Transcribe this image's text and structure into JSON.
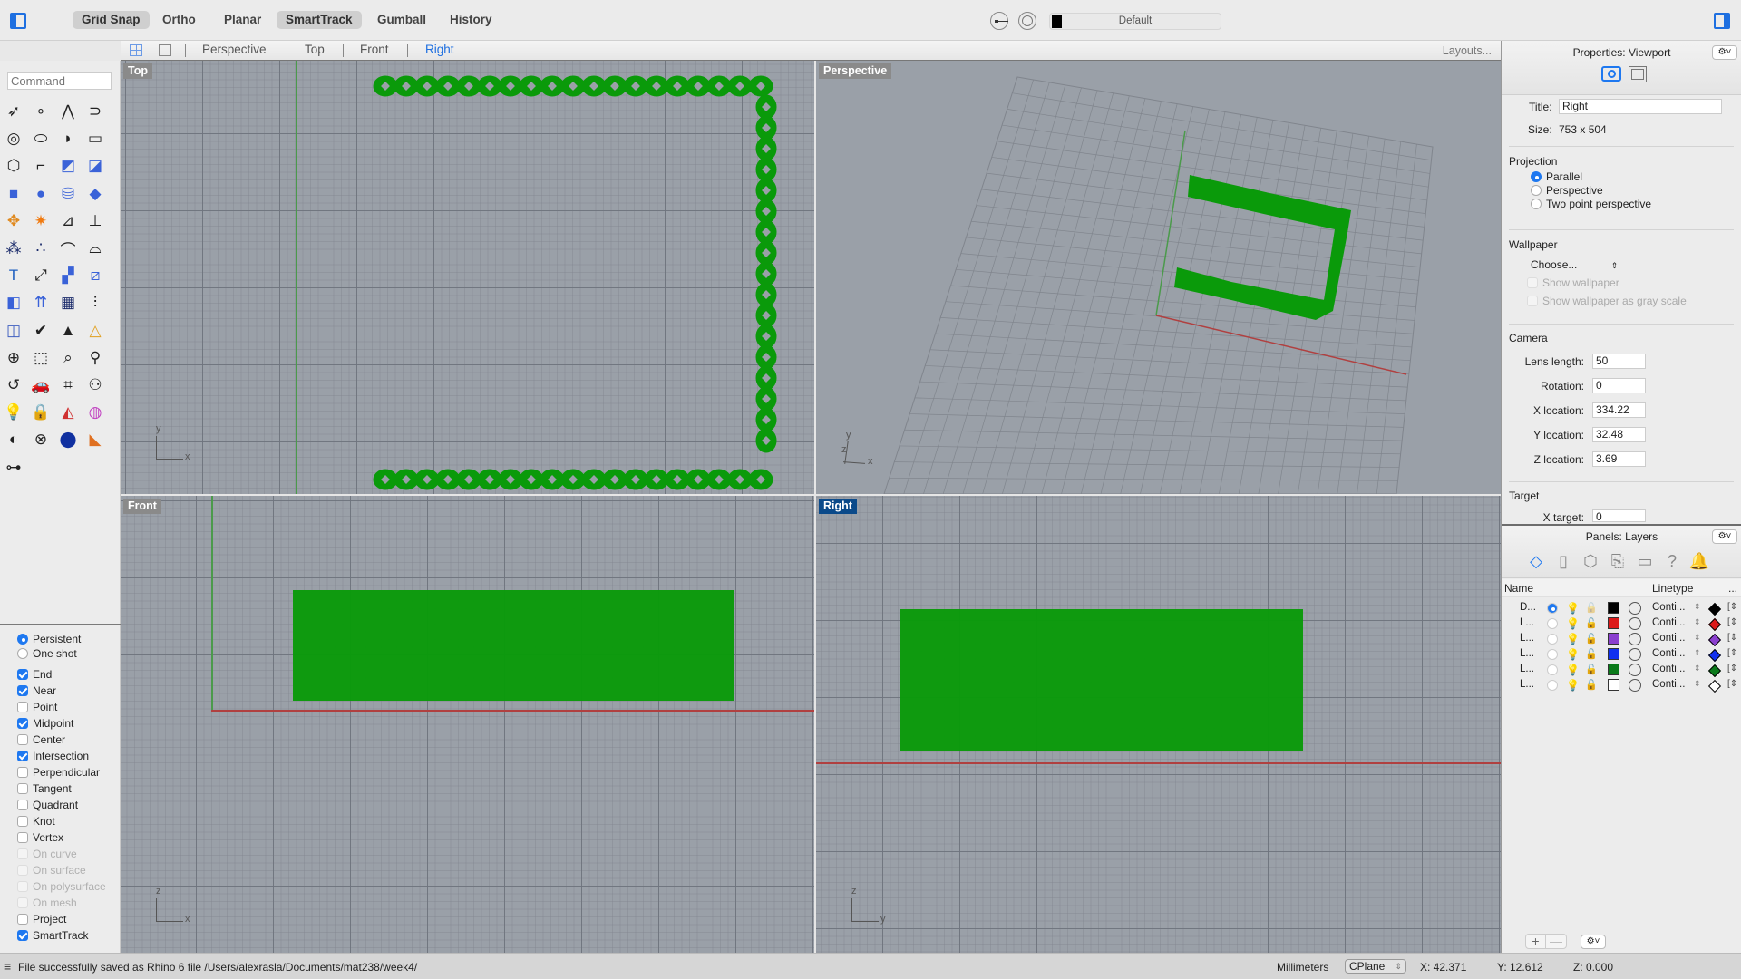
{
  "toolbar": {
    "modes": [
      {
        "label": "Grid Snap",
        "active": true
      },
      {
        "label": "Ortho",
        "active": false
      },
      {
        "label": "Planar",
        "active": false
      },
      {
        "label": "SmartTrack",
        "active": true
      },
      {
        "label": "Gumball",
        "active": false
      },
      {
        "label": "History",
        "active": false
      }
    ],
    "current_layer": "Default",
    "current_layer_color": "#000000"
  },
  "viewport_tabs": {
    "tabs": [
      "Perspective",
      "Top",
      "Front",
      "Right"
    ],
    "active": "Right",
    "layouts_label": "Layouts..."
  },
  "command": {
    "placeholder": "Command"
  },
  "tool_icons": [
    "select-arrow-icon",
    "point-icon",
    "polyline-icon",
    "curve-icon",
    "circle-icon",
    "ellipse-icon",
    "arc-icon",
    "rectangle-icon",
    "polygon-icon",
    "fillet-icon",
    "surface-from-points-icon",
    "sweep-surface-icon",
    "box-icon",
    "sphere-icon",
    "cylinder-icon",
    "extrude-surface-icon",
    "boolean-union-icon",
    "explode-icon",
    "trim-icon",
    "split-icon",
    "group-icon",
    "ungroup-icon",
    "rebuild-curve-icon",
    "offset-curve-icon",
    "text-icon",
    "scale-icon",
    "array-objects-icon",
    "transform-icon",
    "solid-edit-icon",
    "extrude-arrows-icon",
    "array-grid-icon",
    "gumball-icon",
    "analyze-icon",
    "check-icon",
    "render-objects-icon",
    "pyramid-icon",
    "zoom-in-icon",
    "zoom-window-icon",
    "zoom-extents-icon",
    "zoom-selected-icon",
    "rotate-view-icon",
    "car-icon",
    "cplane-icon",
    "named-views-icon",
    "light-bulb-icon",
    "lock-icon",
    "layer-materials-icon",
    "color-wheel-icon",
    "shaded-sphere-icon",
    "wireframe-sphere-icon",
    "render-sphere-icon",
    "cone-render-icon",
    "dimension-icon"
  ],
  "osnap": {
    "mode_options": [
      {
        "label": "Persistent",
        "selected": true
      },
      {
        "label": "One shot",
        "selected": false
      }
    ],
    "items": [
      {
        "label": "End",
        "checked": true,
        "enabled": true
      },
      {
        "label": "Near",
        "checked": true,
        "enabled": true
      },
      {
        "label": "Point",
        "checked": false,
        "enabled": true
      },
      {
        "label": "Midpoint",
        "checked": true,
        "enabled": true
      },
      {
        "label": "Center",
        "checked": false,
        "enabled": true
      },
      {
        "label": "Intersection",
        "checked": true,
        "enabled": true
      },
      {
        "label": "Perpendicular",
        "checked": false,
        "enabled": true
      },
      {
        "label": "Tangent",
        "checked": false,
        "enabled": true
      },
      {
        "label": "Quadrant",
        "checked": false,
        "enabled": true
      },
      {
        "label": "Knot",
        "checked": false,
        "enabled": true
      },
      {
        "label": "Vertex",
        "checked": false,
        "enabled": true
      },
      {
        "label": "On curve",
        "checked": false,
        "enabled": false
      },
      {
        "label": "On surface",
        "checked": false,
        "enabled": false
      },
      {
        "label": "On polysurface",
        "checked": false,
        "enabled": false
      },
      {
        "label": "On mesh",
        "checked": false,
        "enabled": false
      },
      {
        "label": "Project",
        "checked": false,
        "enabled": true
      },
      {
        "label": "SmartTrack",
        "checked": true,
        "enabled": true
      }
    ]
  },
  "viewports": {
    "top": {
      "label": "Top",
      "axis1": "y",
      "axis2": "x"
    },
    "perspective": {
      "label": "Perspective",
      "axis1": "y",
      "axis2": "x",
      "axis3": "z"
    },
    "front": {
      "label": "Front",
      "axis1": "z",
      "axis2": "x"
    },
    "right": {
      "label": "Right",
      "axis1": "z",
      "axis2": "y",
      "active": true
    },
    "object_color": "#0a9a0a"
  },
  "properties": {
    "title": "Properties: Viewport",
    "title_label": "Title:",
    "title_value": "Right",
    "size_label": "Size:",
    "size_value": "753 x 504",
    "projection_label": "Projection",
    "projection_options": [
      {
        "label": "Parallel",
        "selected": true
      },
      {
        "label": "Perspective",
        "selected": false
      },
      {
        "label": "Two point perspective",
        "selected": false
      }
    ],
    "wallpaper_label": "Wallpaper",
    "wallpaper_choose": "Choose...",
    "show_wallpaper": "Show wallpaper",
    "show_wallpaper_gray": "Show wallpaper as gray scale",
    "camera_label": "Camera",
    "camera_fields": [
      {
        "label": "Lens length:",
        "value": "50"
      },
      {
        "label": "Rotation:",
        "value": "0"
      },
      {
        "label": "X location:",
        "value": "334.22"
      },
      {
        "label": "Y location:",
        "value": "32.48"
      },
      {
        "label": "Z location:",
        "value": "3.69"
      }
    ],
    "target_label": "Target",
    "target_fields": [
      {
        "label": "X target:",
        "value": "0"
      }
    ]
  },
  "layers": {
    "title": "Panels: Layers",
    "tab_icons": [
      "layers-icon",
      "document-icon",
      "object-properties-icon",
      "notes-icon",
      "display-icon",
      "help-icon",
      "notifications-icon"
    ],
    "columns": {
      "name": "Name",
      "linetype": "Linetype",
      "more": "..."
    },
    "rows": [
      {
        "name": "D...",
        "current": true,
        "on": false,
        "locked": false,
        "color": "#000000",
        "linetype": "Conti...",
        "print_color": "#000000"
      },
      {
        "name": "L...",
        "current": false,
        "on": true,
        "locked": true,
        "color": "#dd1a1a",
        "linetype": "Conti...",
        "print_color": "#dd1a1a"
      },
      {
        "name": "L...",
        "current": false,
        "on": true,
        "locked": true,
        "color": "#8b3fcf",
        "linetype": "Conti...",
        "print_color": "#8b3fcf"
      },
      {
        "name": "L...",
        "current": false,
        "on": true,
        "locked": true,
        "color": "#1130f0",
        "linetype": "Conti...",
        "print_color": "#1130f0"
      },
      {
        "name": "L...",
        "current": false,
        "on": true,
        "locked": true,
        "color": "#0a7a1a",
        "linetype": "Conti...",
        "print_color": "#0a7a1a"
      },
      {
        "name": "L...",
        "current": false,
        "on": true,
        "locked": true,
        "color": "#ffffff",
        "linetype": "Conti...",
        "print_color": "#ffffff"
      }
    ],
    "add_label": "+",
    "remove_label": "—"
  },
  "status": {
    "message": "File successfully saved as Rhino 6 file /Users/alexrasla/Documents/mat238/week4/",
    "units": "Millimeters",
    "cplane": "CPlane",
    "x": "X: 42.371",
    "y": "Y: 12.612",
    "z": "Z: 0.000"
  }
}
